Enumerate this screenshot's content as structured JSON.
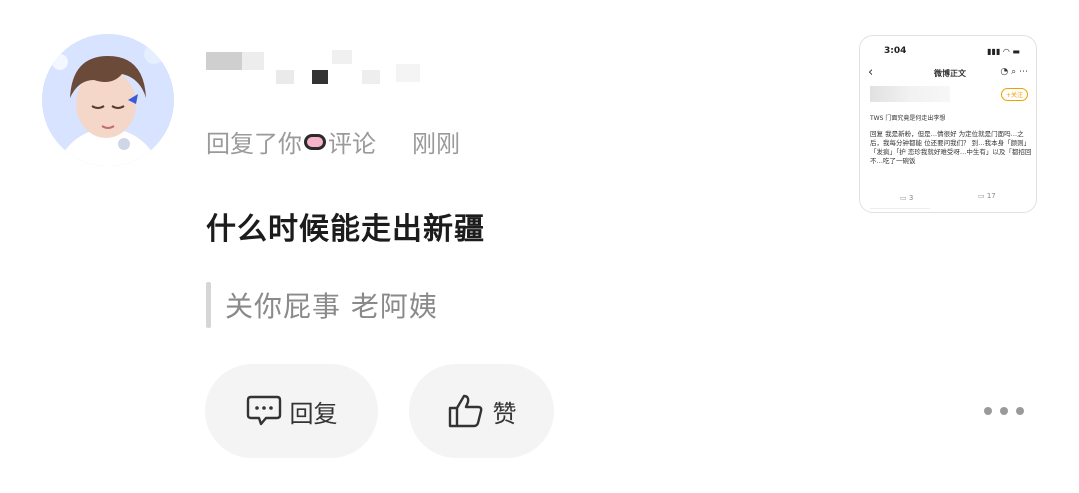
{
  "comment": {
    "author_name": "",
    "action_prefix": "回复了你",
    "action_suffix": "评论",
    "time": "刚刚",
    "reply_text": "什么时候能走出新疆",
    "quoted_text": "关你屁事  老阿姨"
  },
  "actions": {
    "reply_label": "回复",
    "like_label": "赞",
    "more_icon": "more-dots-icon"
  },
  "thumbnail": {
    "status_time": "3:04",
    "page_title": "微博正文",
    "follow_label": "+关注",
    "post_title": "TWS 门面究竟是何走出李想",
    "body_text": "回复 我是新粉，但是…情很好 为定位就是门面吗…之后，我每分钟都能 位还要问我们？ 到…我本身「颜则」「发疯」「护 恋珍我就好难受呀…中生有」以及「都招回不…吃了一碗饭",
    "comments_count": "3",
    "likes_count": "17"
  },
  "colors": {
    "background": "#ffffff",
    "button_bg": "#f4f4f4",
    "muted_text": "#9a9a9a",
    "main_text": "#1c1c1c"
  }
}
